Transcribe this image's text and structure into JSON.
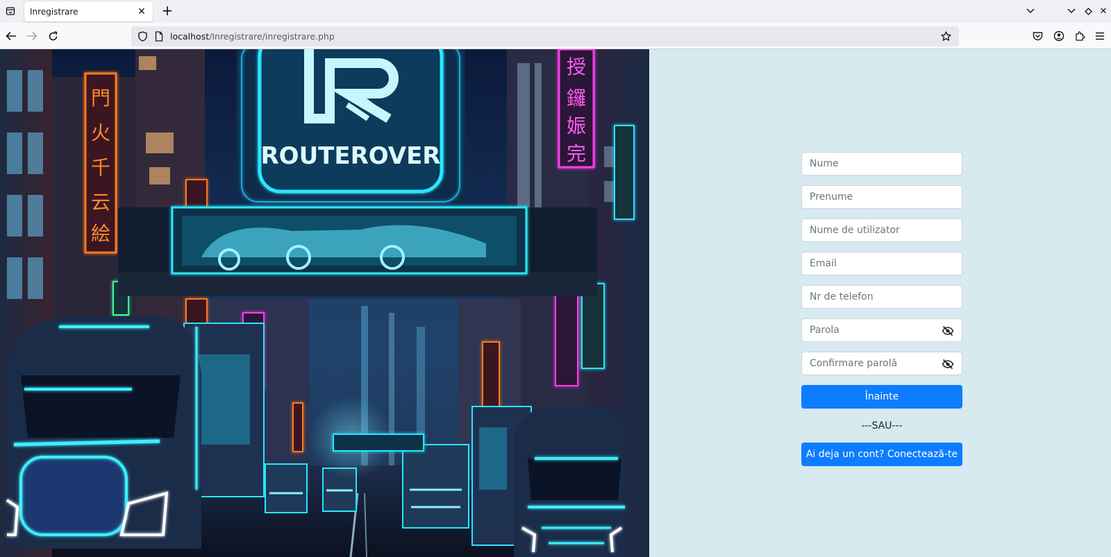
{
  "browser": {
    "tab_title": "Inregistrare",
    "url_host": "localhost",
    "url_path": "/Inregistrare/inregistrare.php"
  },
  "hero": {
    "sign_text": "ROUTEROVER",
    "sign_letter": "R",
    "colors": {
      "cyan": "#29e6ff",
      "magenta": "#ff3ce8",
      "orange": "#ff7a1f",
      "sky": "#0b1a3a"
    }
  },
  "form": {
    "fields": [
      {
        "placeholder": "Nume"
      },
      {
        "placeholder": "Prenume"
      },
      {
        "placeholder": "Nume de utilizator"
      },
      {
        "placeholder": "Email"
      },
      {
        "placeholder": "Nr de telefon"
      },
      {
        "placeholder": "Parola"
      },
      {
        "placeholder": "Confirmare parolă"
      }
    ],
    "next_button": "Înainte",
    "separator": "---SAU---",
    "login_button": "Ai deja un cont? Conectează-te",
    "accent": "#0d7cff",
    "background": "#d6eaf0"
  }
}
